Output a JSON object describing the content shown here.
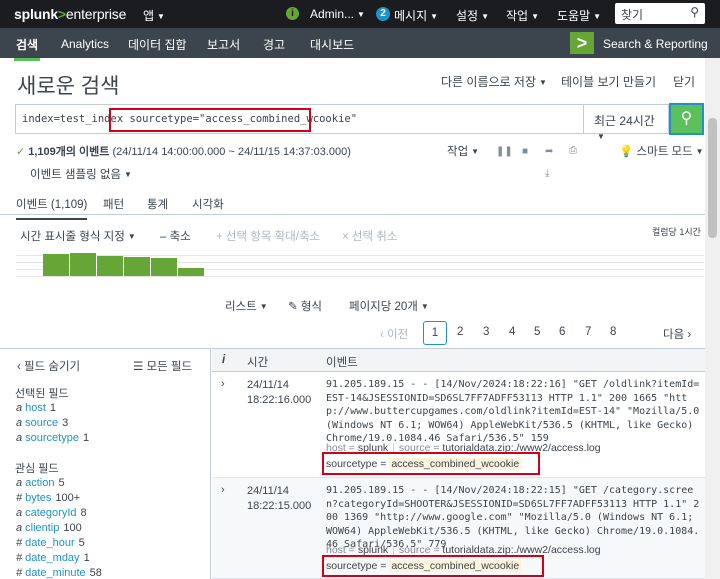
{
  "topbar": {
    "logo_brand": "splunk",
    "logo_gt": ">",
    "logo_product": "enterprise",
    "app_menu": "앱",
    "admin": "Admin...",
    "messages_count": "2",
    "messages": "메시지",
    "settings": "설정",
    "activity": "작업",
    "help": "도움말",
    "find_placeholder": "찾기",
    "info_glyph": "i"
  },
  "appbar": {
    "tabs": [
      "검색",
      "Analytics",
      "데이터 집합",
      "보고서",
      "경고",
      "대시보드"
    ],
    "app_title": "Search & Reporting"
  },
  "page": {
    "title": "새로운 검색",
    "save_as": "다른 이름으로 저장",
    "create_table": "테이블 보기 만들기",
    "close": "닫기"
  },
  "search": {
    "query_prefix": "index=test_index ",
    "query_highlight": "sourcetype=\"access_combined_wcookie\"",
    "time_range": "최근 24시간"
  },
  "status": {
    "count": "1,109개의 이벤트",
    "range": "(24/11/14 14:00:00.000 ~ 24/11/15 14:37:03.000)",
    "sampling": "이벤트 샘플링 없음",
    "job": "작업",
    "smart_mode": "스마트 모드"
  },
  "tabs": {
    "events": "이벤트 (1,109)",
    "patterns": "패턴",
    "statistics": "통계",
    "visualization": "시각화"
  },
  "timeline_controls": {
    "format": "시간 표시줄 형식 지정",
    "zoom_out": "– 축소",
    "zoom_selection": "+ 선택 항목 확대/축소",
    "deselect": "× 선택 취소",
    "scale": "컬럼당 1시간",
    "bars": [
      0.0,
      0.9,
      0.95,
      0.85,
      0.8,
      0.75,
      0.35
    ]
  },
  "list_controls": {
    "list": "리스트",
    "format": "형식",
    "per_page": "페이지당 20개"
  },
  "pager": {
    "prev": "‹ 이전",
    "pages": [
      "1",
      "2",
      "3",
      "4",
      "5",
      "6",
      "7",
      "8"
    ],
    "next": "다음 ›"
  },
  "sidebar": {
    "hide_fields": "‹ 필드 숨기기",
    "all_fields": "모든 필드",
    "selected_header": "선택된 필드",
    "selected": [
      {
        "type": "a",
        "name": "host",
        "count": "1"
      },
      {
        "type": "a",
        "name": "source",
        "count": "3"
      },
      {
        "type": "a",
        "name": "sourcetype",
        "count": "1"
      }
    ],
    "interesting_header": "관심 필드",
    "interesting": [
      {
        "type": "a",
        "name": "action",
        "count": "5"
      },
      {
        "type": "#",
        "name": "bytes",
        "count": "100+"
      },
      {
        "type": "a",
        "name": "categoryId",
        "count": "8"
      },
      {
        "type": "a",
        "name": "clientip",
        "count": "100"
      },
      {
        "type": "#",
        "name": "date_hour",
        "count": "5"
      },
      {
        "type": "#",
        "name": "date_mday",
        "count": "1"
      },
      {
        "type": "#",
        "name": "date_minute",
        "count": "58"
      }
    ]
  },
  "table": {
    "col_i": "i",
    "col_time": "시간",
    "col_event": "이벤트",
    "rows": [
      {
        "date": "24/11/14",
        "time": "18:22:16.000",
        "raw": "91.205.189.15 - - [14/Nov/2024:18:22:16] \"GET /oldlink?itemId=EST-14&JSESSIONID=SD6SL7FF7ADFF53113 HTTP 1.1\" 200 1665 \"http://www.buttercupgames.com/oldlink?itemId=EST-14\" \"Mozilla/5.0 (Windows NT 6.1; WOW64) AppleWebKit/536.5 (KHTML, like Gecko) Chrome/19.0.1084.46 Safari/536.5\" 159",
        "host_key": "host =",
        "host": "splunk",
        "source_key": "source =",
        "source": "tutorialdata.zip:./www2/access.log",
        "st_key": "sourcetype =",
        "st": "access_combined_wcookie"
      },
      {
        "date": "24/11/14",
        "time": "18:22:15.000",
        "raw": "91.205.189.15 - - [14/Nov/2024:18:22:15] \"GET /category.screen?categoryId=SHOOTER&JSESSIONID=SD6SL7FF7ADFF53113 HTTP 1.1\" 200 1369 \"http://www.google.com\" \"Mozilla/5.0 (Windows NT 6.1; WOW64) AppleWebKit/536.5 (KHTML, like Gecko) Chrome/19.0.1084.46 Safari/536.5\" 779",
        "host_key": "host =",
        "host": "splunk",
        "source_key": "source =",
        "source": "tutorialdata.zip:./www2/access.log",
        "st_key": "sourcetype =",
        "st": "access_combined_wcookie"
      }
    ]
  },
  "colors": {
    "topbar": "#1a1c20",
    "appbar": "#3c444d",
    "accent_green": "#65a637",
    "search_button": "#5cc05c",
    "highlight_red": "#d0021b",
    "link_blue": "#1e93c6"
  }
}
